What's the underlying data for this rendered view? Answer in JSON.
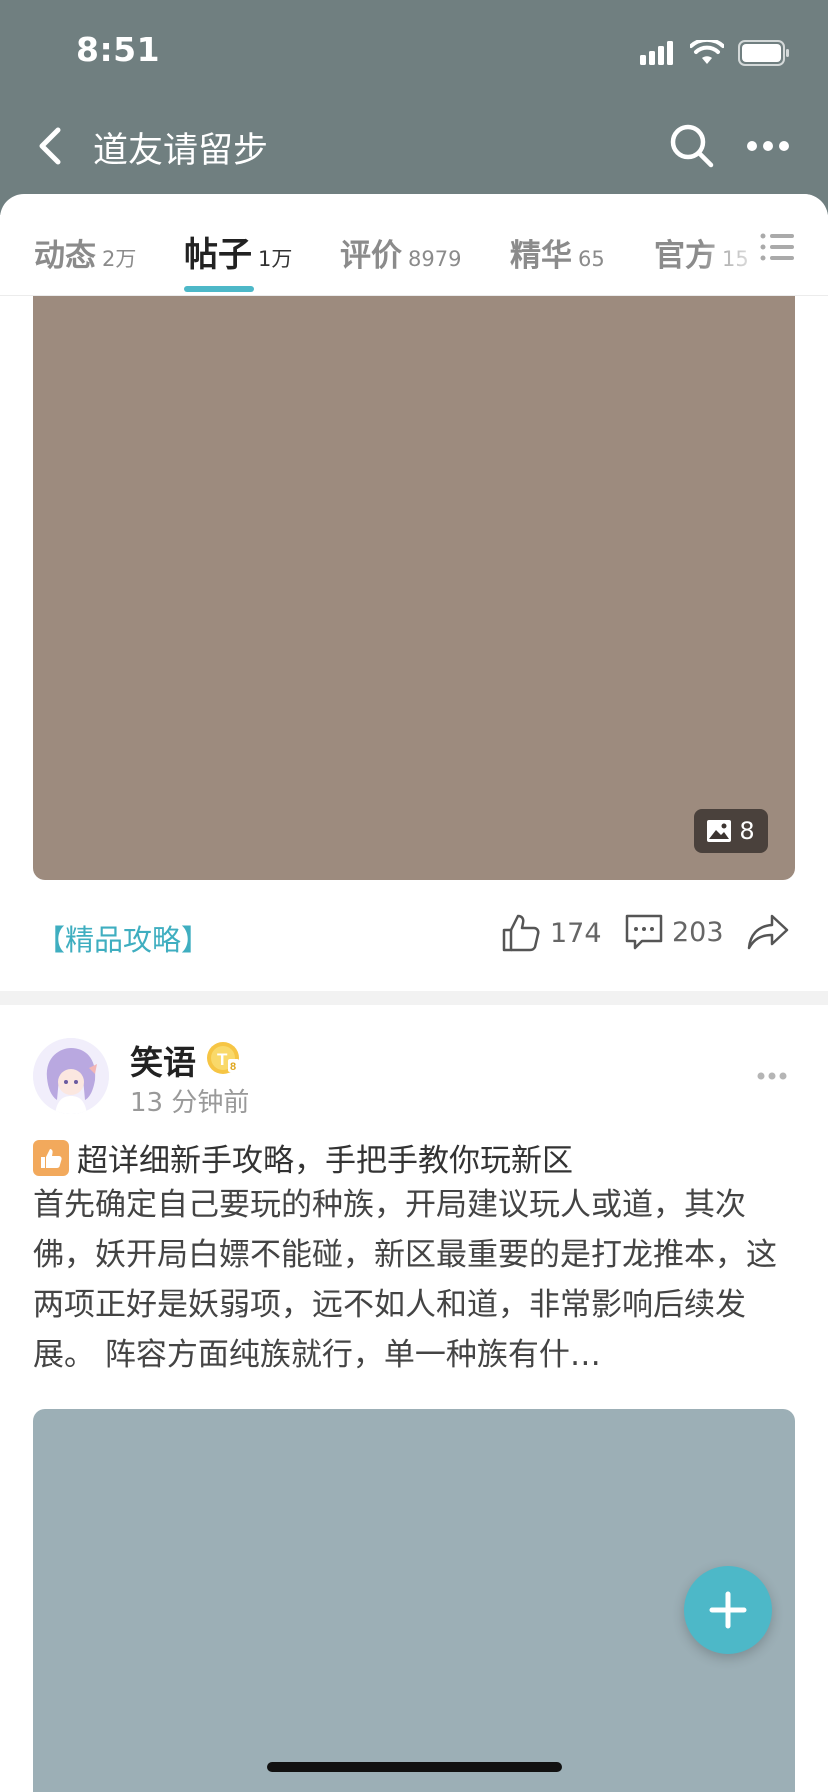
{
  "status_bar": {
    "time": "8:51"
  },
  "nav": {
    "title": "道友请留步"
  },
  "tabs": [
    {
      "label": "动态",
      "count": "2万"
    },
    {
      "label": "帖子",
      "count": "1万"
    },
    {
      "label": "评价",
      "count": "8979"
    },
    {
      "label": "精华",
      "count": "65"
    },
    {
      "label": "官方",
      "count": "15"
    }
  ],
  "active_tab": "帖子",
  "post1": {
    "image_count": "8",
    "tag": "【精品攻略】",
    "likes": "174",
    "comments": "203"
  },
  "post2": {
    "author": "笑语",
    "time": "13 分钟前",
    "title": "超详细新手攻略，手把手教你玩新区",
    "body": "首先确定自己要玩的种族，开局建议玩人或道，其次佛，妖开局白嫖不能碰，新区最重要的是打龙推本，这两项正好是妖弱项，远不如人和道，非常影响后续发展。 阵容方面纯族就行，单一种族有什…"
  },
  "colors": {
    "header_bg": "#707f80",
    "accent": "#4db8c8",
    "image1_bg": "#9d8b7e",
    "image2_bg": "#9cafb6",
    "thumb_badge": "#f2a95c"
  }
}
